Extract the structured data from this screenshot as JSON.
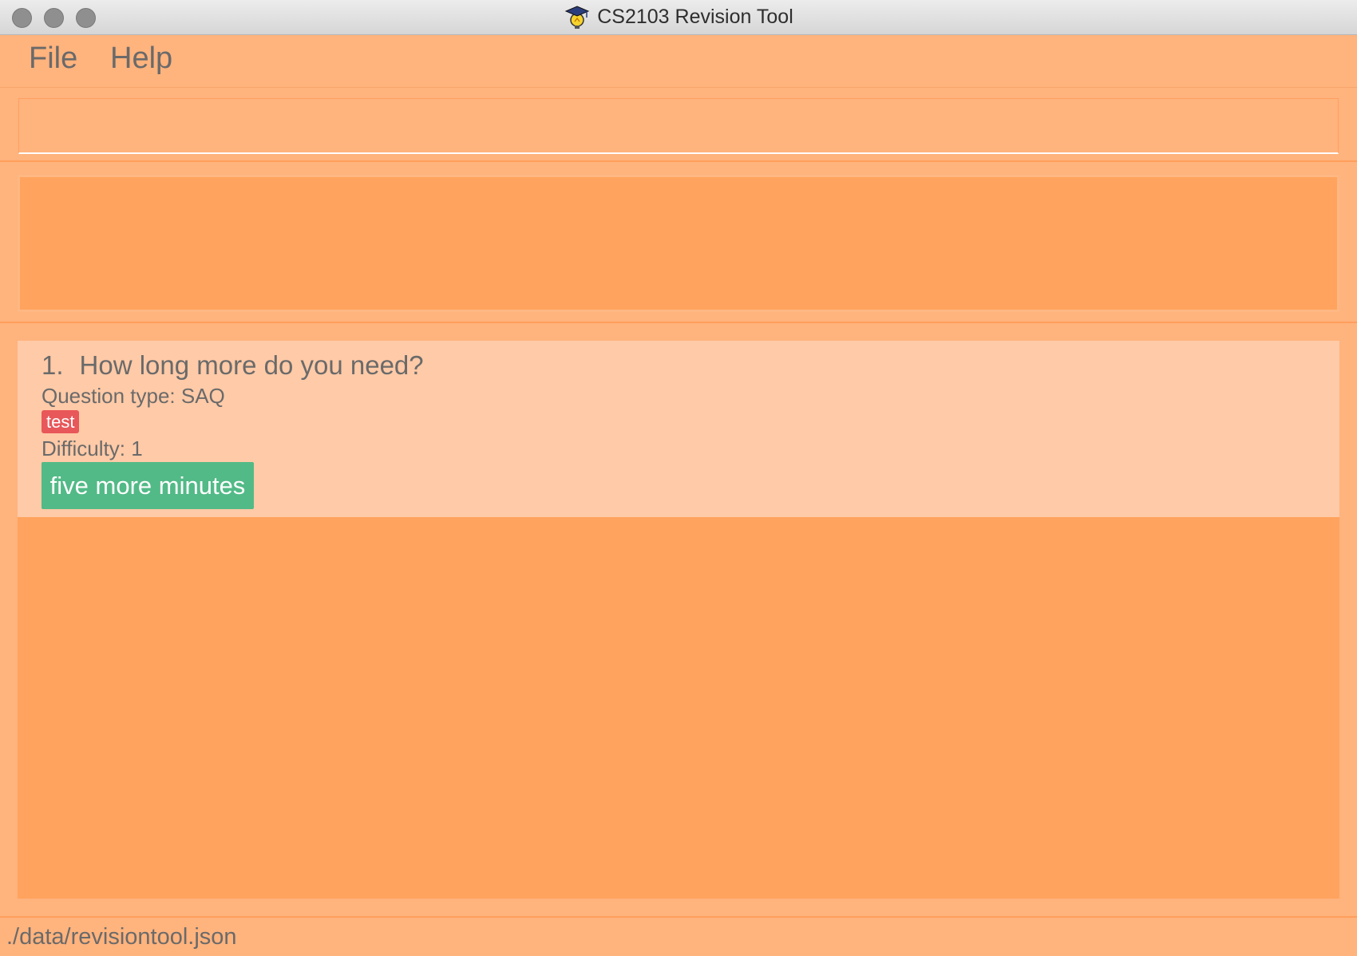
{
  "window": {
    "title": "CS2103 Revision Tool",
    "controls": [
      "close",
      "minimize",
      "maximize"
    ]
  },
  "menu": {
    "file_label": "File",
    "help_label": "Help"
  },
  "command_box": {
    "value": "",
    "placeholder": ""
  },
  "result_display": {
    "text": ""
  },
  "question_list": {
    "items": [
      {
        "index": "1.",
        "question": "How long more do you need?",
        "type_text": "Question type: SAQ",
        "tag": "test",
        "difficulty_text": "Difficulty: 1",
        "answer": "five more minutes"
      }
    ]
  },
  "status_bar": {
    "path": "./data/revisiontool.json"
  },
  "colors": {
    "background": "#ffb37d",
    "panel": "#ffa35e",
    "card": "#ffcaa7",
    "tag": "#e8575a",
    "answer": "#52ba87",
    "text": "#6a6a6a"
  },
  "icons": {
    "app": "graduation-cap-lightbulb-icon"
  }
}
